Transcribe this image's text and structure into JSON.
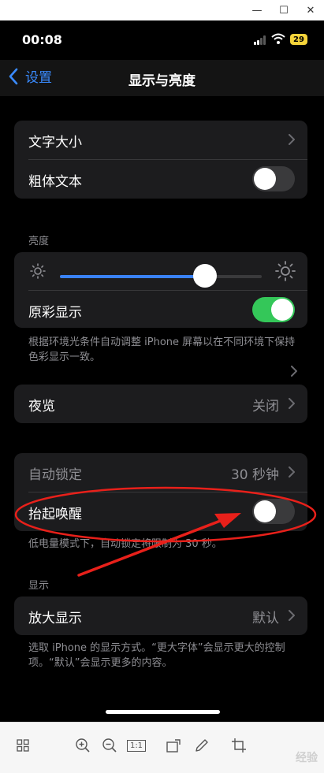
{
  "window": {
    "minimize_glyph": "—",
    "maximize_glyph": "☐",
    "close_glyph": "✕"
  },
  "status_bar": {
    "time": "00:08",
    "battery": "29"
  },
  "nav": {
    "back_label": "设置",
    "title": "显示与亮度"
  },
  "text_group": {
    "text_size_label": "文字大小",
    "bold_text_label": "粗体文本",
    "bold_text_on": false
  },
  "brightness": {
    "section_label": "亮度",
    "level": 0.72,
    "true_tone_label": "原彩显示",
    "true_tone_on": true,
    "footnote": "根据环境光条件自动调整 iPhone 屏幕以在不同环境下保持色彩显示一致。"
  },
  "night_shift": {
    "label": "夜览",
    "value": "关闭"
  },
  "lock_group": {
    "auto_lock_label": "自动锁定",
    "auto_lock_value": "30 秒钟",
    "raise_to_wake_label": "抬起唤醒",
    "raise_to_wake_on": false,
    "footnote": "低电量模式下，自动锁定将限制为 30 秒。"
  },
  "display": {
    "section_label": "显示",
    "zoom_label": "放大显示",
    "zoom_value": "默认",
    "footnote": "选取 iPhone 的显示方式。“更大字体”会显示更大的控制项。“默认”会显示更多的内容。"
  },
  "toolbar": {
    "grid_icon": "grid-icon",
    "zoom_in_icon": "zoom-in-icon",
    "zoom_out_icon": "zoom-out-icon",
    "actual_size_label": "1:1",
    "rotate_icon": "rotate-icon",
    "edit_icon": "pencil-icon",
    "crop_icon": "crop-icon",
    "watermark": "经验"
  },
  "colors": {
    "accent_blue": "#3a82f7",
    "toggle_green": "#34c759",
    "annotation_red": "#e8201a"
  }
}
